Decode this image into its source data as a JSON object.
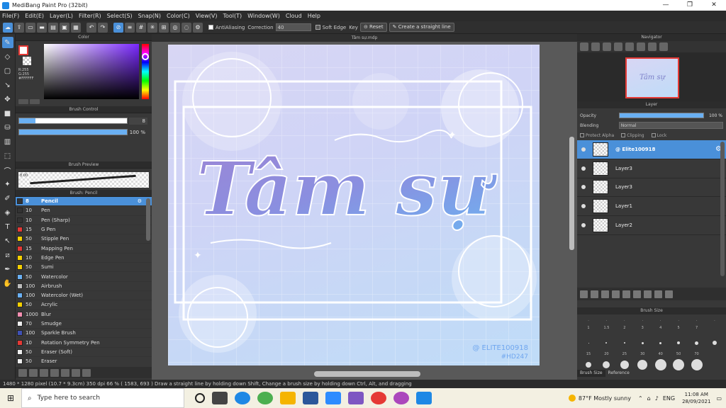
{
  "window": {
    "title": "MediBang Paint Pro (32bit)",
    "min": "—",
    "max": "❐",
    "close": "✕"
  },
  "menu": [
    "File(F)",
    "Edit(E)",
    "Layer(L)",
    "Filter(R)",
    "Select(S)",
    "Snap(N)",
    "Color(C)",
    "View(V)",
    "Tool(T)",
    "Window(W)",
    "Cloud",
    "Help"
  ],
  "toolbar": {
    "antialiasing": "AntiAliasing",
    "correction_label": "Correction",
    "correction_value": "40",
    "soft_edge": "Soft Edge",
    "key": "Key",
    "reset": "Reset",
    "straight_line": "Create a straight line"
  },
  "color_panel": {
    "title": "Color",
    "rgb": [
      "R:255",
      "G:255",
      "#FFFFFF"
    ],
    "accent": "#7a28ff"
  },
  "brush_control": {
    "title": "Brush Control",
    "size_value": "8",
    "size_fill": 0.15,
    "opacity_value": "100 %",
    "opacity_fill": 1.0
  },
  "brush_preview": {
    "title": "Brush Preview",
    "mini_label": "8.00"
  },
  "brush_panel": {
    "title": "Brush: Pencil",
    "items": [
      {
        "size": "8",
        "name": "Pencil",
        "color": "#333333",
        "selected": true
      },
      {
        "size": "10",
        "name": "Pen",
        "color": "#333333"
      },
      {
        "size": "10",
        "name": "Pen (Sharp)",
        "color": "#333333"
      },
      {
        "size": "15",
        "name": "G Pen",
        "color": "#e53935"
      },
      {
        "size": "50",
        "name": "Stipple Pen",
        "color": "#f5d000"
      },
      {
        "size": "15",
        "name": "Mapping Pen",
        "color": "#e53935"
      },
      {
        "size": "10",
        "name": "Edge Pen",
        "color": "#f5d000"
      },
      {
        "size": "50",
        "name": "Sumi",
        "color": "#f5d000"
      },
      {
        "size": "50",
        "name": "Watercolor",
        "color": "#6ab0f3"
      },
      {
        "size": "100",
        "name": "Airbrush",
        "color": "#bbbbbb"
      },
      {
        "size": "100",
        "name": "Watercolor (Wet)",
        "color": "#6ab0f3"
      },
      {
        "size": "50",
        "name": "Acrylic",
        "color": "#f5d000"
      },
      {
        "size": "1000",
        "name": "Blur",
        "color": "#f48fb1"
      },
      {
        "size": "70",
        "name": "Smudge",
        "color": "#eeeeee"
      },
      {
        "size": "100",
        "name": "Sparkle Brush",
        "color": "#3f51b5"
      },
      {
        "size": "10",
        "name": "Rotation Symmetry Pen",
        "color": "#e53935"
      },
      {
        "size": "50",
        "name": "Eraser (Soft)",
        "color": "#eeeeee"
      },
      {
        "size": "50",
        "name": "Eraser",
        "color": "#eeeeee"
      }
    ]
  },
  "document": {
    "tab": "Tâm sự.mdp",
    "art_text": "Tâm sự",
    "watermark_1": "@ ELITE100918",
    "watermark_2": "#HD247"
  },
  "navigator": {
    "title": "Navigator",
    "thumb_text": "Tâm sự"
  },
  "layer_panel": {
    "title": "Layer",
    "opacity_label": "Opacity",
    "opacity_value": "100 %",
    "blending_label": "Blending",
    "blending_value": "Normal",
    "protect_alpha": "Protect Alpha",
    "clipping": "Clipping",
    "lock": "Lock",
    "layers": [
      {
        "name": "@ Elite100918",
        "selected": true
      },
      {
        "name": "Layer3"
      },
      {
        "name": "Layer3"
      },
      {
        "name": "Layer1"
      },
      {
        "name": "Layer2"
      }
    ]
  },
  "brush_size": {
    "title": "Brush Size",
    "row1": [
      ".",
      ".",
      ".",
      ".",
      ".",
      ".",
      ".",
      "."
    ],
    "row2": [
      "1",
      "1.5",
      "2",
      "3",
      "4",
      "5",
      "7",
      ""
    ],
    "row3": [
      "15",
      "20",
      "25",
      "30",
      "40",
      "50",
      "70",
      ""
    ],
    "dots1": [
      1,
      2,
      2,
      3,
      3,
      4,
      5,
      6
    ],
    "dots2": [
      8,
      10,
      12,
      14,
      16,
      16,
      16,
      0
    ],
    "tab_brush": "Brush Size",
    "tab_reference": "Reference"
  },
  "status": "1480 * 1280 pixel  (10.7 * 9.3cm)  350 dpi  66 %  ( 1583, 693 )  Draw a straight line by holding down Shift, Change a brush size by holding down Ctrl, Alt, and dragging",
  "taskbar": {
    "search_placeholder": "Type here to search",
    "weather": "87°F  Mostly sunny",
    "lang": "ENG",
    "time": "11:08 AM",
    "date": "28/09/2021"
  }
}
